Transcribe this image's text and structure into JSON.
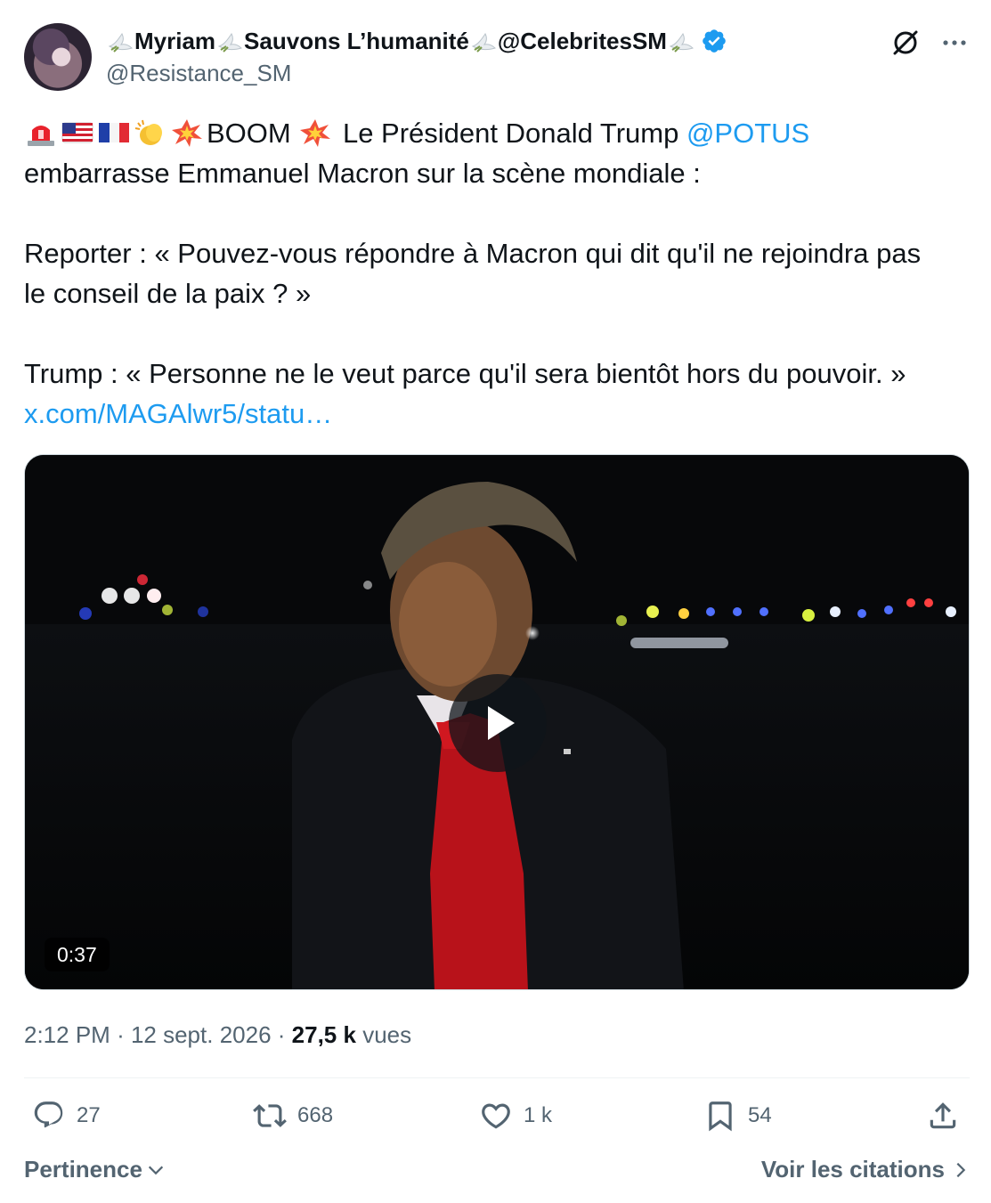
{
  "author": {
    "name_parts": [
      "Myriam",
      "Sauvons L’humanité",
      "@CelebritesSM"
    ],
    "handle": "@Resistance_SM",
    "verified": true
  },
  "header_icons": [
    "grok-icon",
    "more-icon"
  ],
  "tweet": {
    "line1_text": "BOOM ",
    "line1_text2": " Le Président Donald Trump ",
    "mention": "@POTUS",
    "line2": "embarrasse Emmanuel Macron sur la scène mondiale :",
    "line3": "Reporter : « Pouvez-vous répondre à Macron qui dit qu'il ne rejoindra pas",
    "line4": "le conseil de la paix ? »",
    "line5": "Trump : « Personne ne le veut parce qu'il sera bientôt hors du pouvoir. »",
    "link": "x.com/MAGAlwr5/statu…"
  },
  "video": {
    "duration": "0:37"
  },
  "meta": {
    "time": "2:12 PM",
    "date": "12 sept. 2026",
    "views_count": "27,5 k",
    "views_label": "vues"
  },
  "actions": {
    "replies": "27",
    "reposts": "668",
    "likes": "1 k",
    "bookmarks": "54"
  },
  "footer": {
    "sort_label": "Pertinence",
    "quotes_label": "Voir les citations"
  },
  "colors": {
    "accent": "#1d9bf0",
    "text": "#0f1419",
    "secondary": "#536471"
  }
}
